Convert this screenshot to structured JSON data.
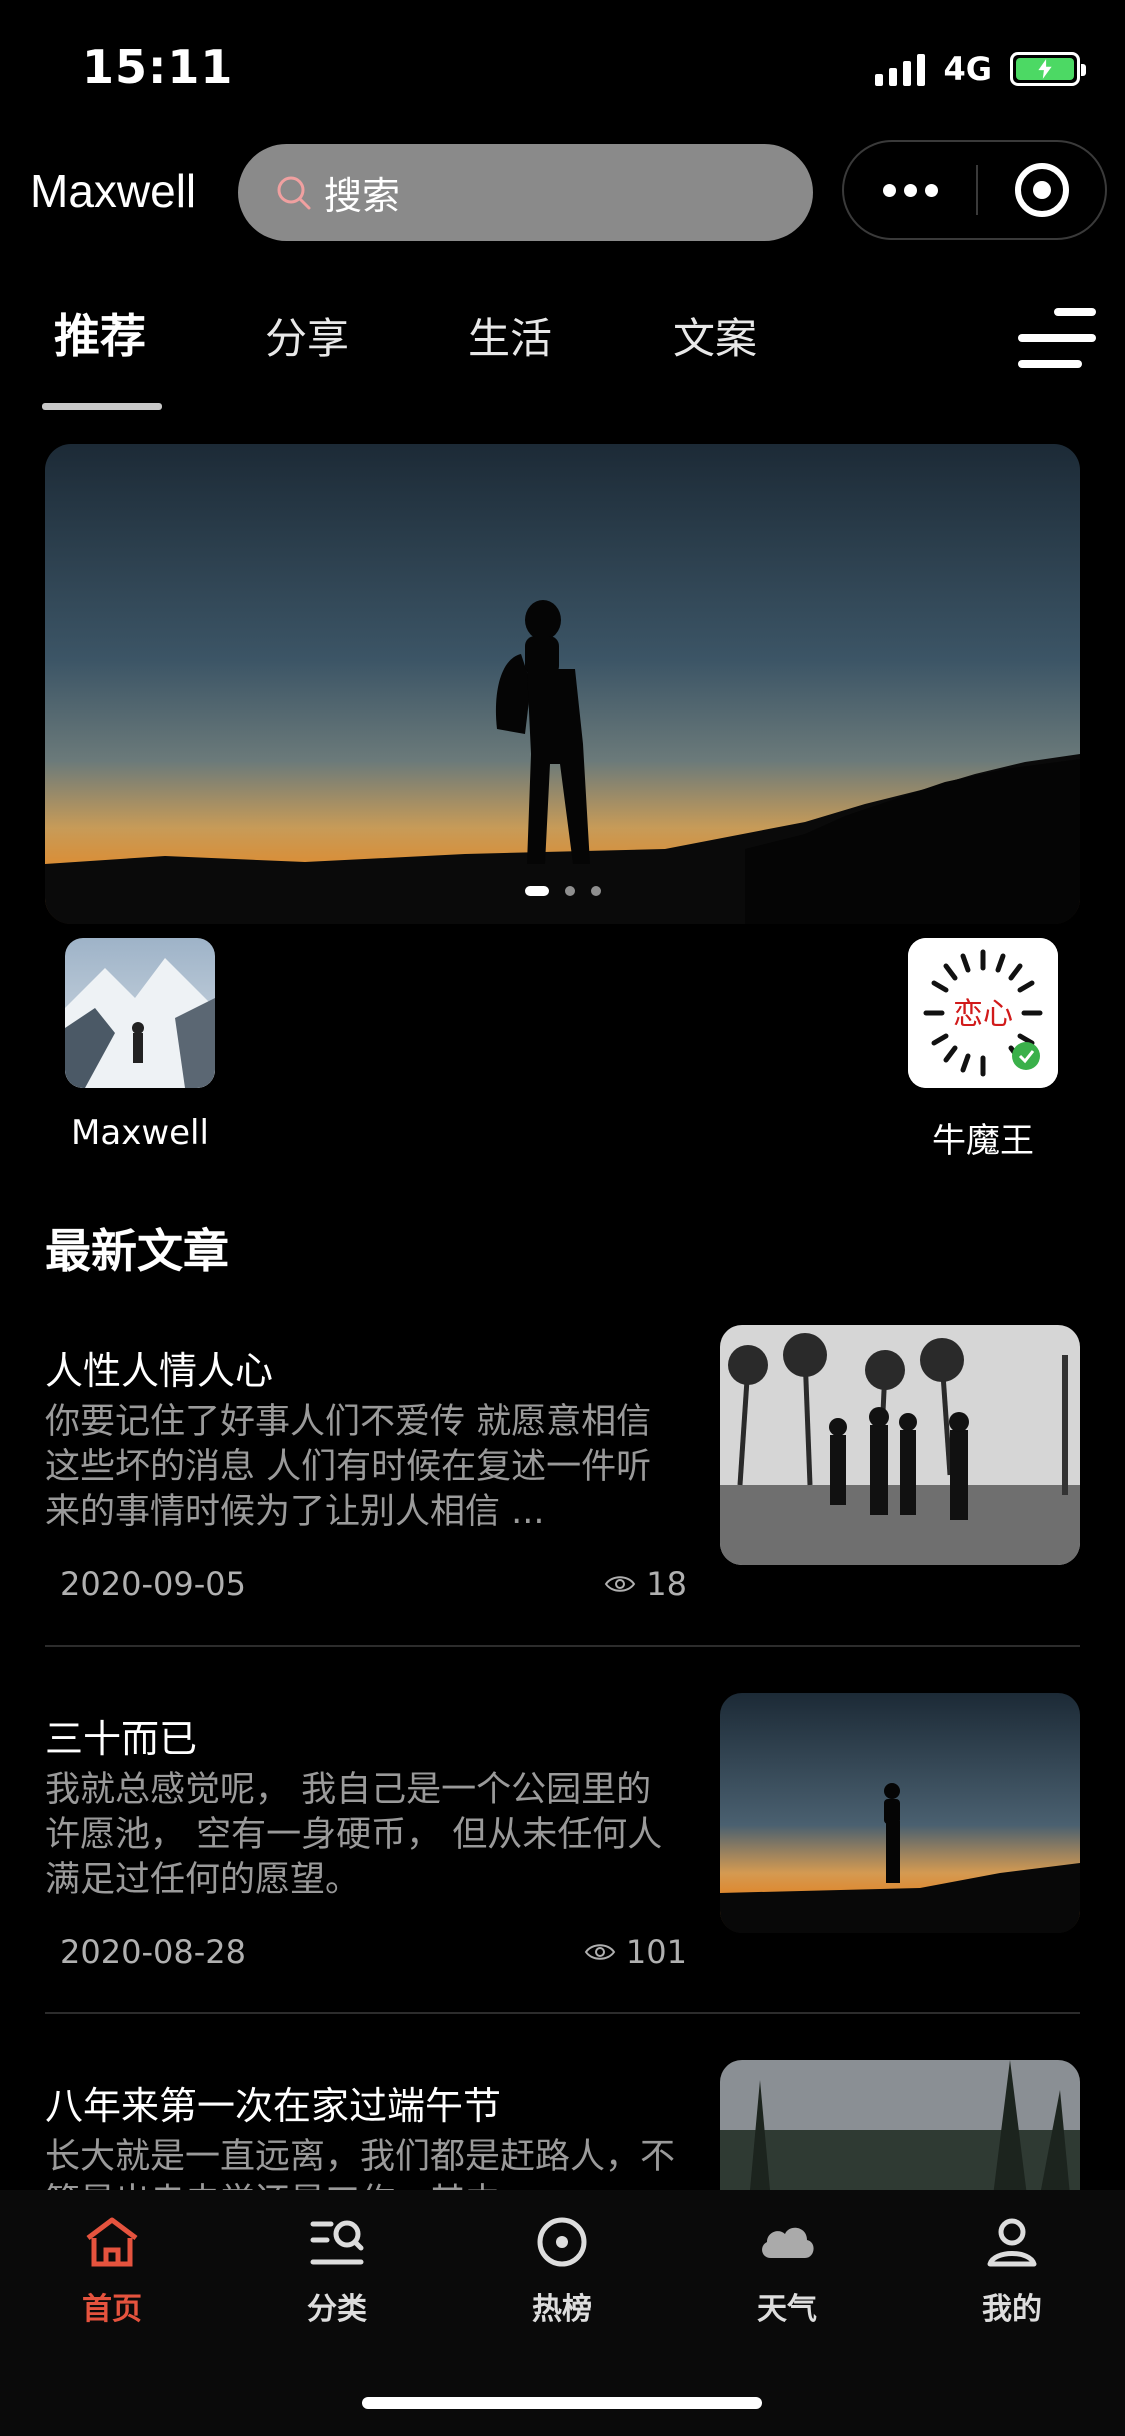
{
  "status_bar": {
    "time": "15:11",
    "network": "4G"
  },
  "header": {
    "brand": "Maxwell",
    "search_placeholder": "搜索"
  },
  "tabs": [
    {
      "label": "推荐",
      "active": true
    },
    {
      "label": "分享",
      "active": false
    },
    {
      "label": "生活",
      "active": false
    },
    {
      "label": "文案",
      "active": false
    }
  ],
  "banner": {
    "slides": 3,
    "active_slide": 1
  },
  "quick_links": [
    {
      "label": "Maxwell"
    },
    {
      "label": "牛魔王",
      "logo_text": "恋心"
    }
  ],
  "section": {
    "title": "最新文章"
  },
  "articles": [
    {
      "title": "人性人情人心",
      "excerpt": "你要记住了好事人们不爱传 就愿意相信这些坏的消息 人们有时候在复述一件听来的事情时候为了让别人相信 ...",
      "date": "2020-09-05",
      "views": "18"
    },
    {
      "title": "三十而已",
      "excerpt": "我就总感觉呢， 我自己是一个公园里的许愿池， 空有一身硬币， 但从未任何人满足过任何的愿望。",
      "date": "2020-08-28",
      "views": "101"
    },
    {
      "title": "八年来第一次在家过端午节",
      "excerpt": "长大就是一直远离，我们都是赶路人，不管是出走去学还是工作，其中"
    }
  ],
  "tabbar": [
    {
      "label": "首页",
      "icon": "home-icon",
      "active": true
    },
    {
      "label": "分类",
      "icon": "category-icon",
      "active": false
    },
    {
      "label": "热榜",
      "icon": "hot-icon",
      "active": false
    },
    {
      "label": "天气",
      "icon": "cloud-icon",
      "active": false
    },
    {
      "label": "我的",
      "icon": "profile-icon",
      "active": false
    }
  ],
  "colors": {
    "accent": "#e5533e",
    "background": "#000000",
    "search_bg": "#8a8a8a"
  }
}
